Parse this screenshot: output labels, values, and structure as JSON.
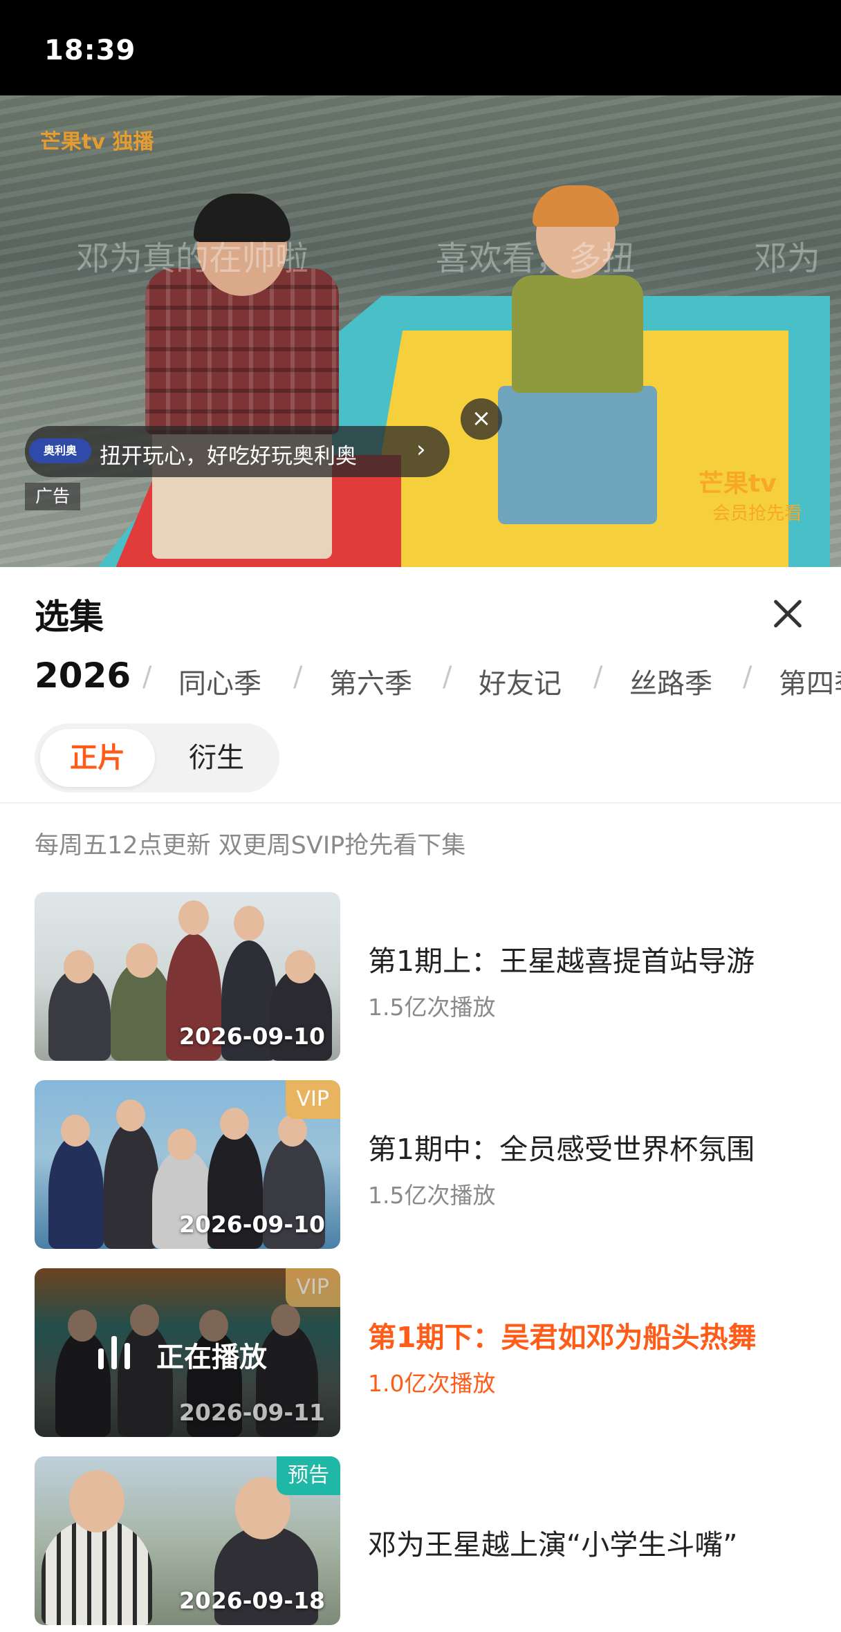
{
  "status_bar": {
    "time": "18:39"
  },
  "video": {
    "danmaku": [
      "邓为真的在帅啦",
      "喜欢看，多扭",
      "邓为"
    ],
    "logo_text": "芒果tv 独播",
    "brand_watermark": "芒果tv",
    "brand_sub": "会员抢先看",
    "ad": {
      "logo": "奥利奥",
      "text": "扭开玩心，好吃好玩奥利奥",
      "arrow": "›",
      "close": "×",
      "label": "广告"
    }
  },
  "panel": {
    "title": "选集",
    "close_icon": "close-icon"
  },
  "season_tabs": [
    "2026",
    "同心季",
    "第六季",
    "好友记",
    "丝路季",
    "第四季"
  ],
  "segment": {
    "active": "正片",
    "other": "衍生"
  },
  "update_note": "每周五12点更新 双更周SVIP抢先看下集",
  "episodes": [
    {
      "title": "第1期上：王星越喜提首站导游",
      "plays": "1.5亿次播放",
      "date": "2026-09-10",
      "badge": ""
    },
    {
      "title": "第1期中：全员感受世界杯氛围",
      "plays": "1.5亿次播放",
      "date": "2026-09-10",
      "badge": "VIP"
    },
    {
      "title": "第1期下：吴君如邓为船头热舞",
      "plays": "1.0亿次播放",
      "date": "2026-09-11",
      "badge": "VIP",
      "playing_label": "正在播放"
    },
    {
      "title": "邓为王星越上演“小学生斗嘴”",
      "plays": "",
      "date": "2026-09-18",
      "badge": "预告"
    }
  ],
  "colors": {
    "accent": "#ff5c19",
    "vip": "#e9b45f",
    "preview": "#1fb7a6"
  }
}
